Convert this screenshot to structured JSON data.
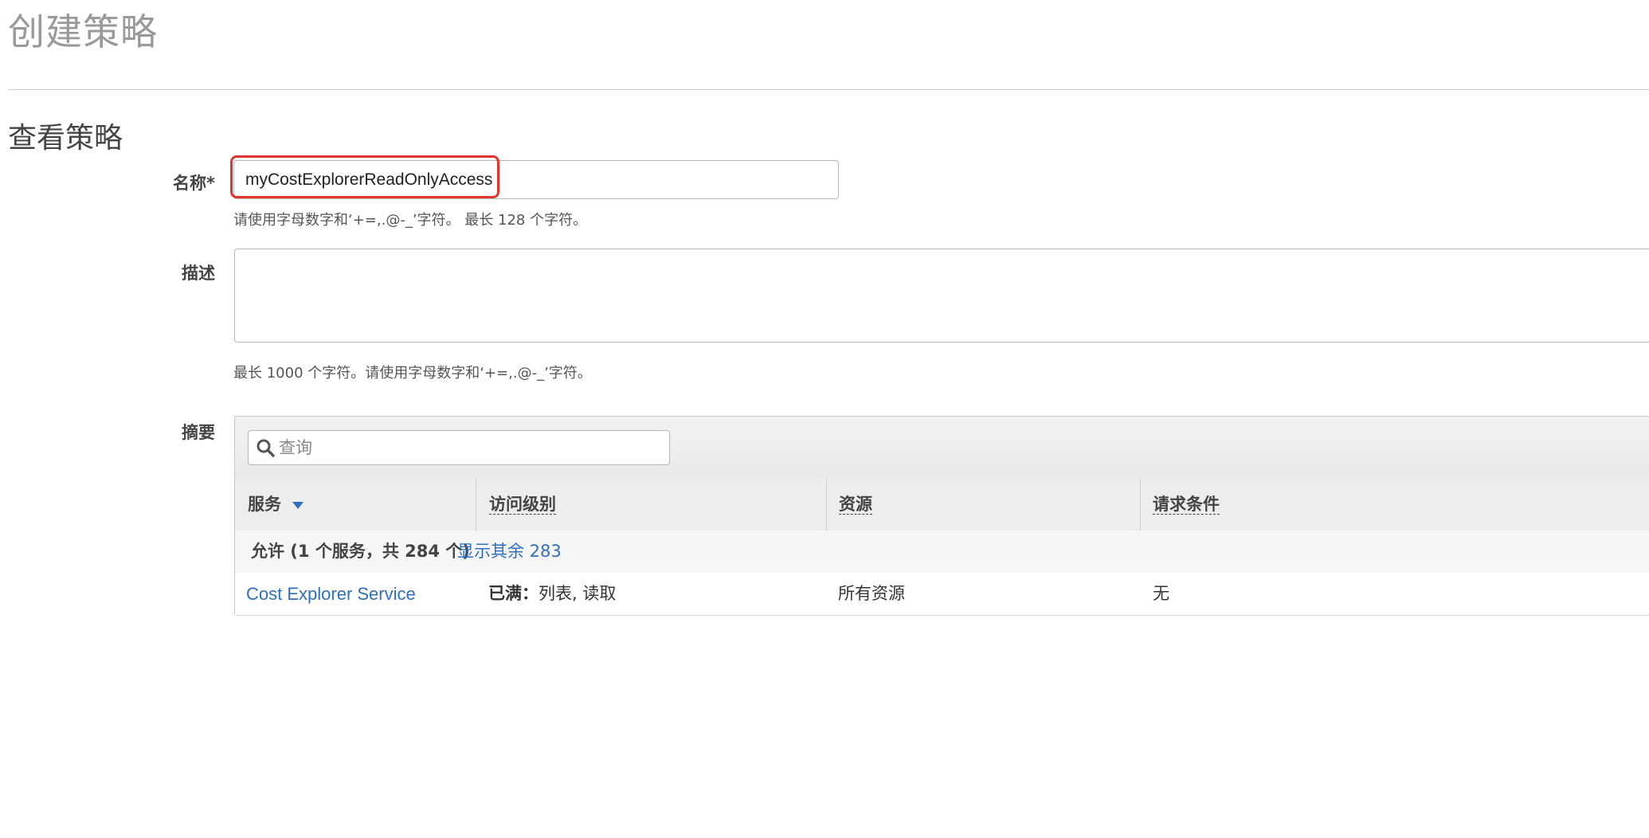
{
  "page": {
    "title": "创建策略"
  },
  "section": {
    "title": "查看策略"
  },
  "name_field": {
    "label": "名称*",
    "value": "myCostExplorerReadOnlyAccess",
    "hint": "请使用字母数字和‘+=,.@-_’字符。 最长 128 个字符。"
  },
  "description_field": {
    "label": "描述",
    "value": "",
    "hint": "最长 1000 个字符。请使用字母数字和‘+=,.@-_’字符。"
  },
  "summary": {
    "label": "摘要",
    "search": {
      "placeholder": "查询",
      "icon": "search-icon"
    },
    "columns": {
      "service": "服务",
      "access_level": "访问级别",
      "resource": "资源",
      "request_condition": "请求条件"
    },
    "group": {
      "text": "允许 (1 个服务，共 284 个)",
      "show_rest_link": "显示其余 283"
    },
    "rows": [
      {
        "service": "Cost Explorer Service",
        "access_level_prefix": "已满：",
        "access_level_value": "列表, 读取",
        "resource": "所有资源",
        "request_condition": "无"
      }
    ]
  },
  "colors": {
    "highlight": "#e2362c",
    "link": "#2e6fbf"
  }
}
